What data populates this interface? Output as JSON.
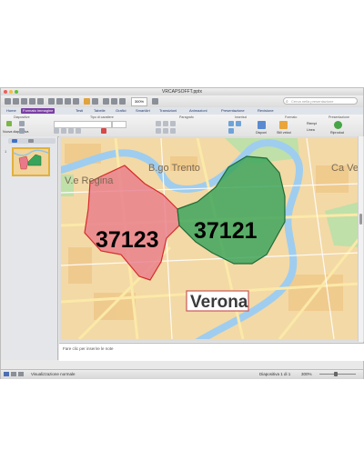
{
  "window": {
    "title": "VRCAPSOFFT.pptx"
  },
  "toolbar": {
    "zoom_value": "300%",
    "search_placeholder": "Cerca nella presentazione"
  },
  "tabs": [
    "Home",
    "Formato immagine",
    "Testi",
    "Tabelle",
    "Grafici",
    "SmartArt",
    "Transizioni",
    "Animazioni",
    "Presentazione",
    "Revisione"
  ],
  "active_tab_index": 1,
  "ribbon": {
    "groups": [
      "Diapositive",
      "Tipo di carattere",
      "Paragrafo",
      "Inserisci",
      "Formato",
      "Presentazione"
    ],
    "new_slide_label": "Nuova diapositiva",
    "arrange_label": "Disponi",
    "quick_styles_label": "Stili veloci",
    "shape_fill_label": "Riempi",
    "line_label": "Linea",
    "play_label": "Riproduci"
  },
  "sidebar": {
    "slide_number": "1"
  },
  "map": {
    "labels": [
      {
        "text": "V.e Regina",
        "name": "place-label-ve-regina"
      },
      {
        "text": "B.go Trento",
        "name": "place-label-bgo-trento"
      },
      {
        "text": "Ca Vero",
        "name": "place-label-ca-vero"
      },
      {
        "text": "Verona",
        "name": "city-label-verona"
      }
    ],
    "zones": [
      {
        "code": "37123",
        "color": "#e8798a"
      },
      {
        "code": "37121",
        "color": "#38a35a"
      }
    ]
  },
  "notes": {
    "placeholder": "Fare clic per inserire le note"
  },
  "status": {
    "view_label": "Visualizzazione normale",
    "slide_indicator": "Diapositiva 1 di 1",
    "zoom": "300%"
  }
}
